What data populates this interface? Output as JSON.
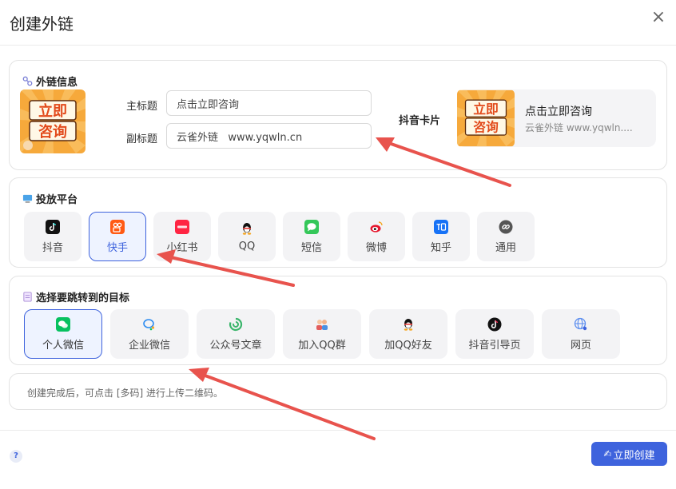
{
  "dialog": {
    "title": "创建外链",
    "close_glyph": "×"
  },
  "info_section": {
    "title": "外链信息",
    "icon": "link-chain-icon",
    "thumbnail_text_line1": "立即",
    "thumbnail_text_line2": "咨询",
    "main_title_label": "主标题",
    "main_title_value": "点击立即咨询",
    "subtitle_label": "副标题",
    "subtitle_value": "云雀外链   www.yqwln.cn",
    "card_label": "抖音卡片",
    "preview_title": "点击立即咨询",
    "preview_sub": "云雀外链  www.yqwln...."
  },
  "platform_section": {
    "title": "投放平台",
    "icon": "monitor-icon",
    "selected": "快手",
    "items": [
      {
        "label": "抖音",
        "icon": "douyin-icon"
      },
      {
        "label": "快手",
        "icon": "kuaishou-icon"
      },
      {
        "label": "小红书",
        "icon": "xiaohongshu-icon"
      },
      {
        "label": "QQ",
        "icon": "qq-penguin-icon"
      },
      {
        "label": "短信",
        "icon": "sms-icon"
      },
      {
        "label": "微博",
        "icon": "weibo-icon"
      },
      {
        "label": "知乎",
        "icon": "zhihu-icon"
      },
      {
        "label": "通用",
        "icon": "link-icon"
      }
    ]
  },
  "target_section": {
    "title": "选择要跳转到的目标",
    "icon": "notebook-icon",
    "selected": "个人微信",
    "items": [
      {
        "label": "个人微信",
        "icon": "wechat-icon"
      },
      {
        "label": "企业微信",
        "icon": "wecom-icon"
      },
      {
        "label": "公众号文章",
        "icon": "official-account-icon"
      },
      {
        "label": "加入QQ群",
        "icon": "qq-group-icon"
      },
      {
        "label": "加QQ好友",
        "icon": "qq-penguin-icon"
      },
      {
        "label": "抖音引导页",
        "icon": "douyin-icon"
      },
      {
        "label": "网页",
        "icon": "globe-icon"
      }
    ]
  },
  "notice": {
    "text": "创建完成后，可点击 [多码] 进行上传二维码。"
  },
  "footer": {
    "help_glyph": "?",
    "create_label": "立即创建",
    "create_icon_glyph": "✍"
  },
  "colors": {
    "primary": "#3e63dd",
    "arrow": "#e8534d",
    "tile_bg": "#f3f3f5",
    "thumb_orange": "#f39a1e"
  }
}
